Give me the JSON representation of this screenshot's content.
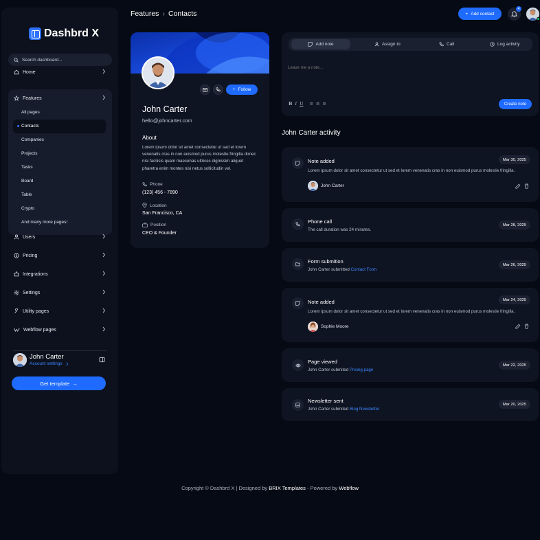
{
  "app": {
    "name": "Dashbrd X",
    "accent": "#1f6bff"
  },
  "sidebar": {
    "search_placeholder": "Search dashboard...",
    "items": [
      {
        "label": "Home",
        "icon": "home-icon"
      },
      {
        "label": "Features",
        "icon": "star-icon"
      },
      {
        "label": "Users",
        "icon": "user-icon"
      },
      {
        "label": "Pricing",
        "icon": "dollar-icon"
      },
      {
        "label": "Integrations",
        "icon": "puzzle-icon"
      },
      {
        "label": "Settings",
        "icon": "gear-icon"
      },
      {
        "label": "Utility pages",
        "icon": "wrench-icon"
      },
      {
        "label": "Webflow pages",
        "icon": "webflow-icon"
      }
    ],
    "features_sub": [
      "All pages",
      "Contacts",
      "Companies",
      "Projects",
      "Tasks",
      "Board",
      "Table",
      "Crypto",
      "And many more pages!"
    ],
    "active_sub": "Contacts",
    "user": {
      "name": "John Carter",
      "link": "Account settings"
    },
    "cta": "Get template"
  },
  "header": {
    "breadcrumb": [
      "Features",
      "Contacts"
    ],
    "add_contact": "Add contact",
    "notification_count": "4"
  },
  "profile": {
    "name": "John Carter",
    "email": "hello@johncarter.com",
    "follow_label": "Follow",
    "about_title": "About",
    "about_text": "Lorem ipsum dolor sit amet consectetur ut sed et lorem venenatis cras in non euismod purus molestie fringilla donec nisi facilisis quam maecenas ultrices dignissim aliquet pharetra enim montes nisi netus sollicitudin vel.",
    "fields": [
      {
        "label": "Phone",
        "value": "(123) 456 - 7890",
        "icon": "phone-icon"
      },
      {
        "label": "Location",
        "value": "San Francisco, CA",
        "icon": "location-pin-icon"
      },
      {
        "label": "Position",
        "value": "CEO & Founder",
        "icon": "briefcase-icon"
      }
    ]
  },
  "note": {
    "tabs": [
      "Add note",
      "Assign to",
      "Call",
      "Log activity"
    ],
    "placeholder": "Leave me a note...",
    "submit": "Create note"
  },
  "activity": {
    "title": "John Carter activity",
    "items": [
      {
        "title": "Note added",
        "date": "Mar 30, 2025",
        "desc": "Lorem ipsum dolor sit amet consectetur ut sed et lorem venenatis cras in non euismod purus molestie fringilla.",
        "user": "John Carter",
        "icon": "note-icon"
      },
      {
        "title": "Phone call",
        "date": "Mar 28, 2025",
        "desc": "The call duration was 24 minutes.",
        "icon": "phone-icon"
      },
      {
        "title": "Form submition",
        "date": "Mar 26, 2025",
        "desc": "John Carter submitted",
        "link": "Contact Form",
        "icon": "folder-icon"
      },
      {
        "title": "Note added",
        "date": "Mar 24, 2025",
        "desc": "Lorem ipsum dolor sit amet consectetur ut sed et lorem venenatis cras in non euismod purus molestie fringilla.",
        "user": "Sophie Moore",
        "icon": "note-icon"
      },
      {
        "title": "Page viewed",
        "date": "Mar 22, 2025",
        "desc": "John Carter submited",
        "link": "Pricing page",
        "icon": "eye-icon"
      },
      {
        "title": "Newsletter sent",
        "date": "Mar 20, 2025",
        "desc": "John Carter submited",
        "link": "Blog Newsletter",
        "icon": "inbox-icon"
      }
    ]
  },
  "footer": {
    "prefix": "Copyright © Dashbrd X | Designed by",
    "brand1": "BRIX Templates",
    "mid": "- Powered by",
    "brand2": "Webflow"
  }
}
